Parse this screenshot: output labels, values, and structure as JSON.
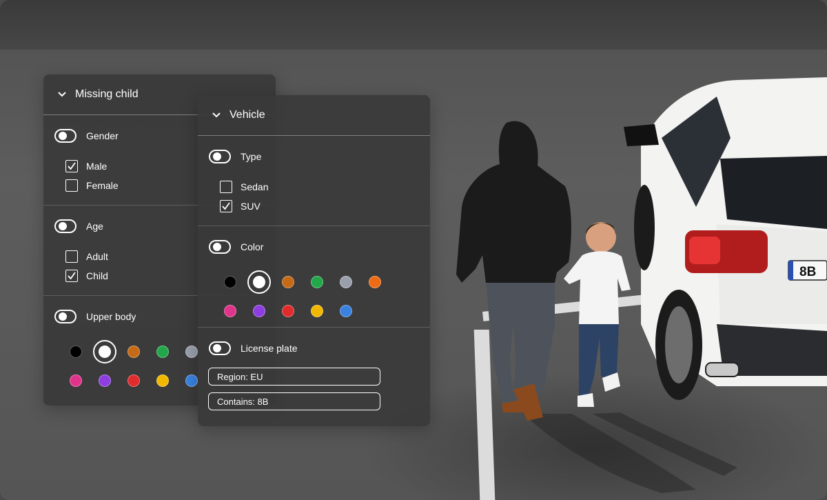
{
  "panel_child": {
    "title": "Missing child",
    "sections": [
      {
        "label": "Gender",
        "options": [
          {
            "label": "Male",
            "checked": true
          },
          {
            "label": "Female",
            "checked": false
          }
        ]
      },
      {
        "label": "Age",
        "options": [
          {
            "label": "Adult",
            "checked": false
          },
          {
            "label": "Child",
            "checked": true
          }
        ]
      },
      {
        "label": "Upper body",
        "colors": [
          [
            "#000000",
            "#ffffff",
            "#c56a16",
            "#22a84a",
            "#9aa0ab"
          ],
          [
            "#e0348a",
            "#8e3ee0",
            "#e02c2c",
            "#f2b800",
            "#3a82e0"
          ]
        ],
        "selected_color": "#ffffff"
      }
    ]
  },
  "panel_vehicle": {
    "title": "Vehicle",
    "sections": [
      {
        "label": "Type",
        "options": [
          {
            "label": "Sedan",
            "checked": false
          },
          {
            "label": "SUV",
            "checked": true
          }
        ]
      },
      {
        "label": "Color",
        "colors": [
          [
            "#000000",
            "#ffffff",
            "#c56a16",
            "#22a84a",
            "#9aa0ab",
            "#ef6a14"
          ],
          [
            "#e0348a",
            "#8e3ee0",
            "#e02c2c",
            "#f2b800",
            "#3a82e0"
          ]
        ],
        "selected_color": "#ffffff"
      },
      {
        "label": "License plate",
        "fields": [
          "Region: EU",
          "Contains: 8B"
        ]
      }
    ]
  },
  "scene": {
    "plate_text": "8B"
  }
}
